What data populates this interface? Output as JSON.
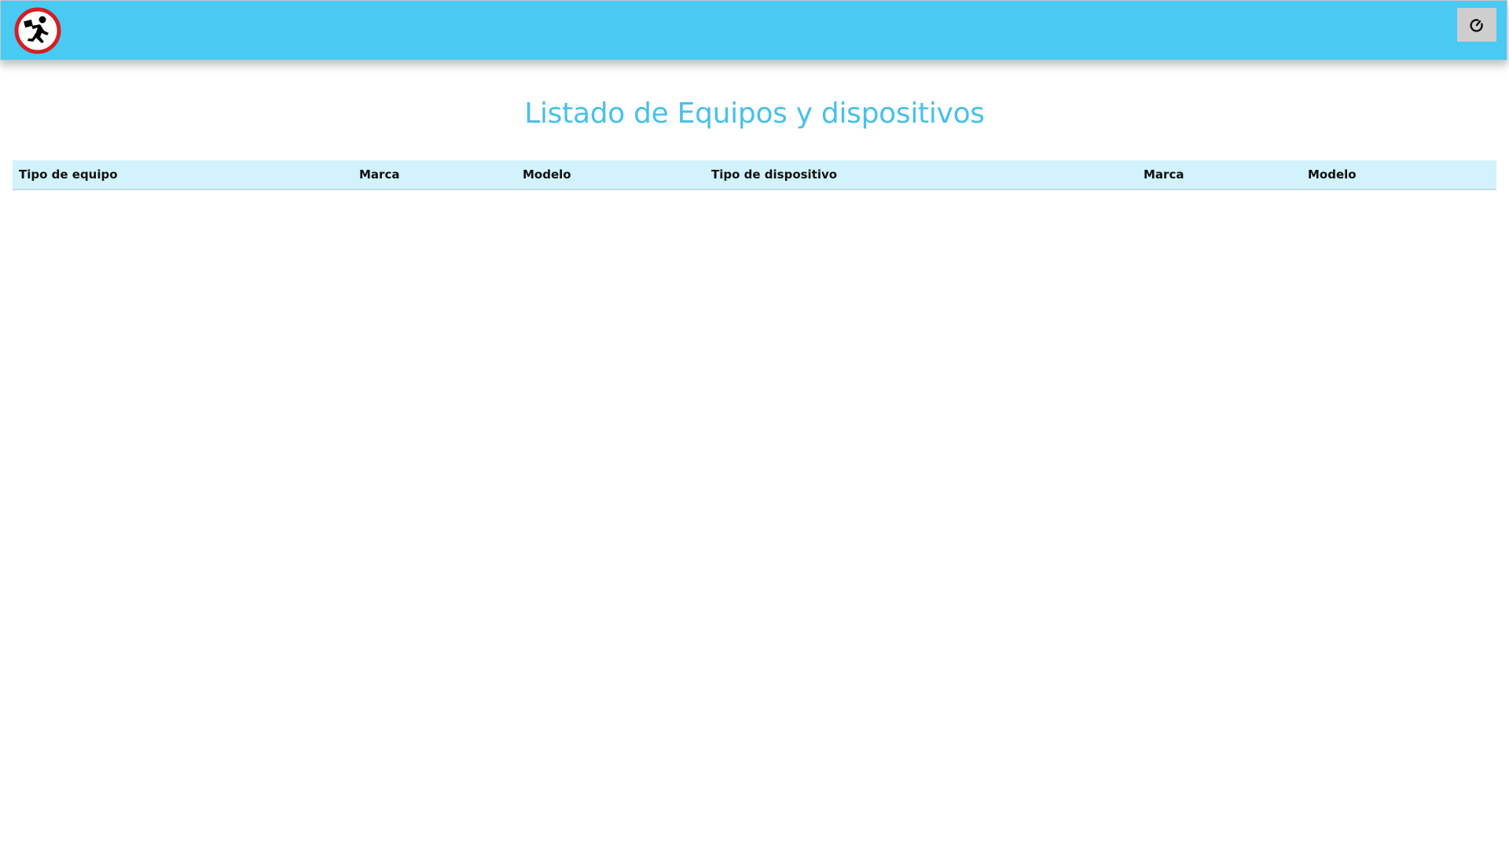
{
  "header": {
    "logo_icon": "running-man-logo-icon",
    "power_icon": "power-icon",
    "accent_color": "#48caf2"
  },
  "main": {
    "title": "Listado de Equipos y dispositivos",
    "table": {
      "columns": [
        "Tipo de equipo",
        "Marca",
        "Modelo",
        "Tipo de dispositivo",
        "Marca",
        "Modelo"
      ],
      "rows": []
    }
  }
}
